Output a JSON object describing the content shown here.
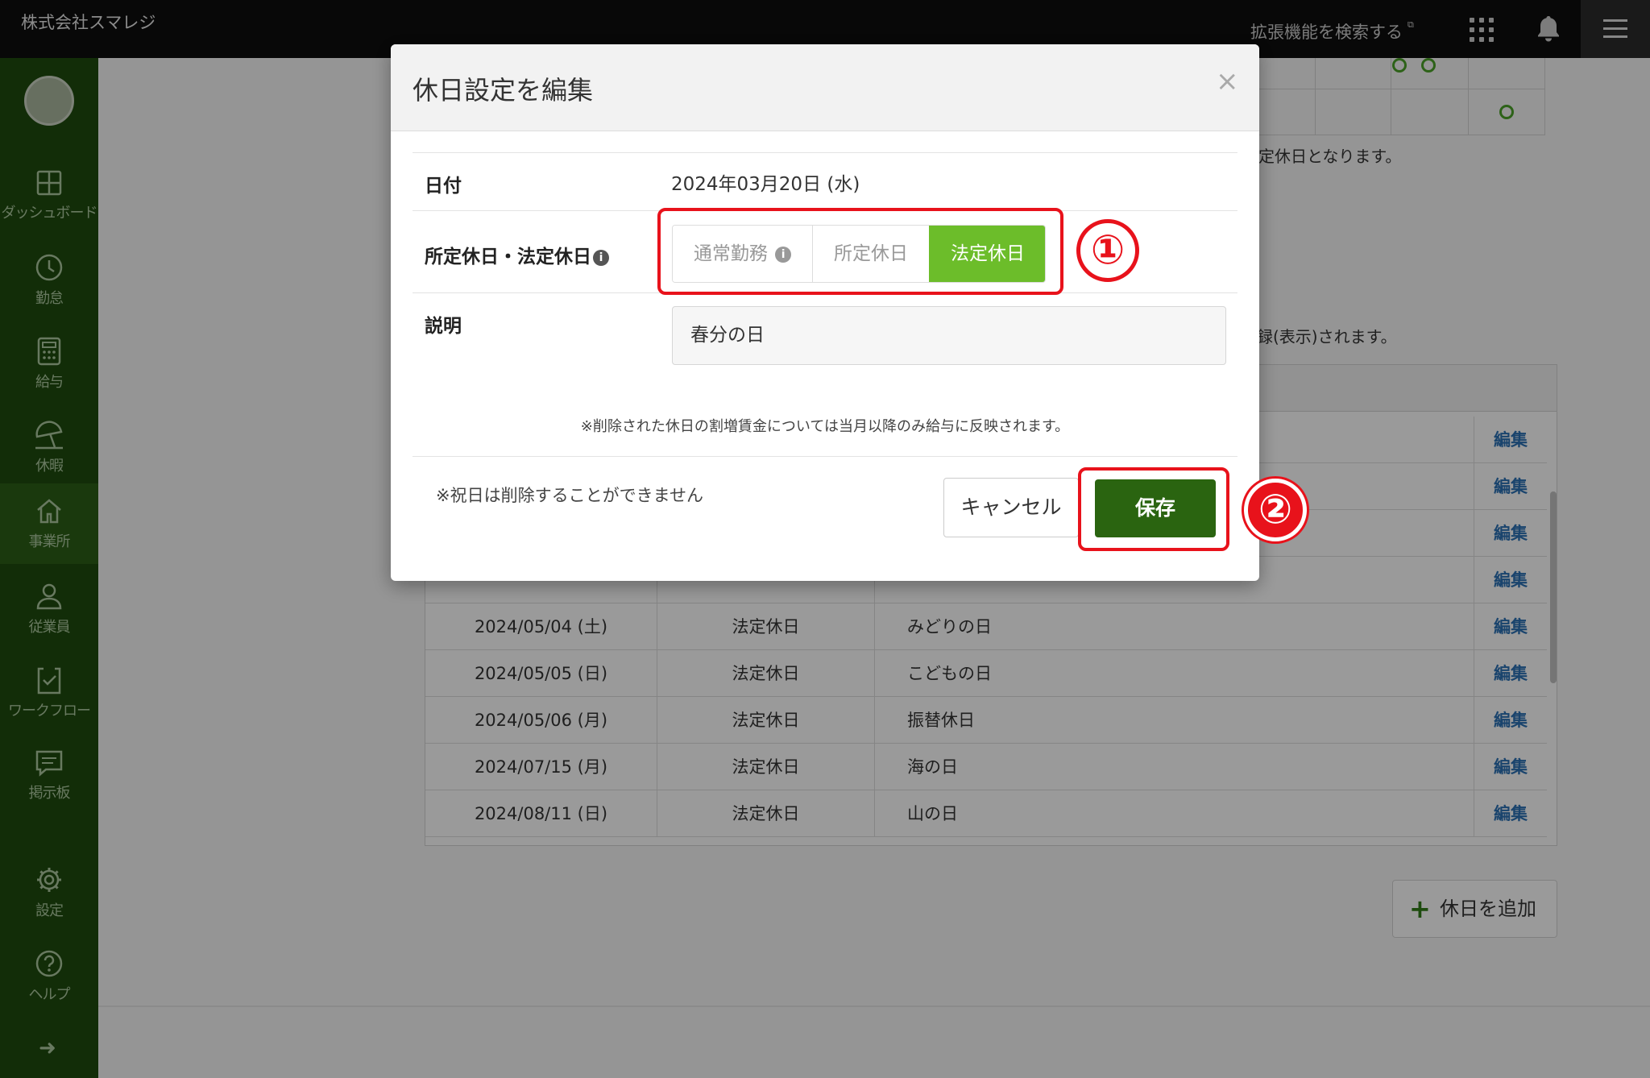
{
  "topbar": {
    "company": "株式会社スマレジ",
    "ext_link": "拡張機能を検索する",
    "icons": [
      "apps-icon",
      "bell-icon",
      "menu-icon"
    ]
  },
  "sidebar": {
    "items": [
      {
        "label": "ダッシュボード",
        "icon": "dashboard-icon"
      },
      {
        "label": "勤怠",
        "icon": "clock-icon"
      },
      {
        "label": "給与",
        "icon": "calculator-icon"
      },
      {
        "label": "休暇",
        "icon": "umbrella-icon"
      },
      {
        "label": "事業所",
        "icon": "home-icon",
        "active": true
      },
      {
        "label": "従業員",
        "icon": "person-icon"
      },
      {
        "label": "ワークフロー",
        "icon": "clipboard-check-icon"
      },
      {
        "label": "掲示板",
        "icon": "message-icon"
      },
      {
        "label": "設定",
        "icon": "gear-icon"
      },
      {
        "label": "ヘルプ",
        "icon": "help-icon"
      }
    ]
  },
  "background": {
    "text_fragment_1": "定休日となります。",
    "text_fragment_2": "録(表示)されます。",
    "rows": [
      {
        "date": "",
        "type": "",
        "desc": "",
        "edit": "編集"
      },
      {
        "date": "",
        "type": "",
        "desc": "",
        "edit": "編集"
      },
      {
        "date": "",
        "type": "",
        "desc": "",
        "edit": "編集"
      },
      {
        "date": "",
        "type": "",
        "desc": "",
        "edit": "編集"
      },
      {
        "date": "2024/05/04 (土)",
        "type": "法定休日",
        "desc": "みどりの日",
        "edit": "編集"
      },
      {
        "date": "2024/05/05 (日)",
        "type": "法定休日",
        "desc": "こどもの日",
        "edit": "編集"
      },
      {
        "date": "2024/05/06 (月)",
        "type": "法定休日",
        "desc": "振替休日",
        "edit": "編集"
      },
      {
        "date": "2024/07/15 (月)",
        "type": "法定休日",
        "desc": "海の日",
        "edit": "編集"
      },
      {
        "date": "2024/08/11 (日)",
        "type": "法定休日",
        "desc": "山の日",
        "edit": "編集"
      }
    ],
    "add_button": "休日を追加"
  },
  "modal": {
    "title": "休日設定を編集",
    "close": "×",
    "date_label": "日付",
    "date_value": "2024年03月20日 (水)",
    "type_label": "所定休日・法定休日",
    "type_options": [
      "通常勤務",
      "所定休日",
      "法定休日"
    ],
    "type_selected": "法定休日",
    "desc_label": "説明",
    "desc_value": "春分の日",
    "note_deleted": "※削除された休日の割増賃金については当月以降のみ給与に反映されます。",
    "note_holiday": "※祝日は削除することができません",
    "cancel": "キャンセル",
    "save": "保存",
    "accent_color": "#6cbd2a",
    "save_color": "#2a6410"
  },
  "annotations": {
    "marker1": "①",
    "marker2": "②",
    "color": "#e8121b"
  }
}
